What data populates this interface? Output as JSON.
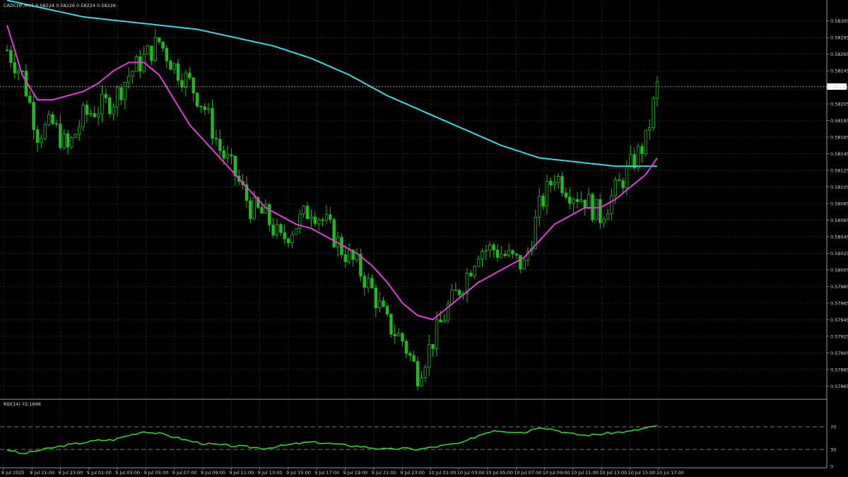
{
  "symbol_header": "CADCHF,M15  0.58224 0.58226 0.58224 0.58226",
  "rsi_header": "RSI(14) 72.1696",
  "colors": {
    "background": "#000000",
    "grid": "#3a3a3a",
    "candle": "#22b922",
    "ma_fast": "#e040d8",
    "ma_slow": "#40d8e0",
    "rsi": "#33dd33",
    "price_tag_bg": "#ffffff",
    "price_tag_text": "#000000",
    "hline": "#bfbfbf"
  },
  "chart_data": [
    {
      "type": "candlestick",
      "symbol": "CADCHF",
      "timeframe": "M15",
      "ylim": [
        0.57855,
        0.58315
      ],
      "price_ticks": [
        "0.58305",
        "0.58285",
        "0.58265",
        "0.58245",
        "0.58225",
        "0.58205",
        "0.58185",
        "0.58165",
        "0.58145",
        "0.58125",
        "0.58105",
        "0.58085",
        "0.58065",
        "0.58045",
        "0.58025",
        "0.58005",
        "0.57985",
        "0.57965",
        "0.57945",
        "0.57925",
        "0.57905",
        "0.57885",
        "0.57865"
      ],
      "current_price": "0.58226",
      "time_labels": [
        "8 Jul 2025",
        "8 Jul 21:00",
        "8 Jul 23:00",
        "9 Jul 01:00",
        "9 Jul 03:00",
        "9 Jul 05:00",
        "9 Jul 07:00",
        "9 Jul 09:00",
        "9 Jul 11:00",
        "9 Jul 13:00",
        "9 Jul 15:00",
        "9 Jul 17:00",
        "9 Jul 19:00",
        "9 Jul 21:00",
        "9 Jul 23:00",
        "10 Jul 01:00",
        "10 Jul 03:00",
        "10 Jul 05:00",
        "10 Jul 07:00",
        "10 Jul 09:00",
        "10 Jul 11:00",
        "10 Jul 13:00",
        "10 Jul 15:00",
        "10 Jul 17:00"
      ],
      "close_path": [
        [
          0,
          0.5827
        ],
        [
          4,
          0.5824
        ],
        [
          8,
          0.5817
        ],
        [
          12,
          0.5818
        ],
        [
          16,
          0.5815
        ],
        [
          20,
          0.5819
        ],
        [
          24,
          0.582
        ],
        [
          28,
          0.5821
        ],
        [
          32,
          0.5824
        ],
        [
          36,
          0.5826
        ],
        [
          40,
          0.5828
        ],
        [
          44,
          0.5825
        ],
        [
          48,
          0.5823
        ],
        [
          52,
          0.582
        ],
        [
          56,
          0.5815
        ],
        [
          60,
          0.5812
        ],
        [
          64,
          0.5808
        ],
        [
          68,
          0.5807
        ],
        [
          72,
          0.5804
        ],
        [
          76,
          0.5806
        ],
        [
          80,
          0.5808
        ],
        [
          84,
          0.5806
        ],
        [
          88,
          0.5803
        ],
        [
          92,
          0.5801
        ],
        [
          96,
          0.5798
        ],
        [
          100,
          0.5794
        ],
        [
          104,
          0.5792
        ],
        [
          108,
          0.5788
        ],
        [
          112,
          0.5792
        ],
        [
          116,
          0.5796
        ],
        [
          120,
          0.5799
        ],
        [
          124,
          0.5803
        ],
        [
          128,
          0.5803
        ],
        [
          132,
          0.5802
        ],
        [
          136,
          0.5801
        ],
        [
          140,
          0.5808
        ],
        [
          144,
          0.5812
        ],
        [
          148,
          0.581
        ],
        [
          152,
          0.5809
        ],
        [
          156,
          0.5807
        ],
        [
          160,
          0.581
        ],
        [
          164,
          0.5813
        ],
        [
          168,
          0.5816
        ],
        [
          171,
          0.58226
        ]
      ],
      "ma_fast": [
        [
          0,
          0.583
        ],
        [
          4,
          0.5824
        ],
        [
          8,
          0.5821
        ],
        [
          12,
          0.5821
        ],
        [
          16,
          0.58215
        ],
        [
          20,
          0.5822
        ],
        [
          24,
          0.5823
        ],
        [
          28,
          0.58245
        ],
        [
          32,
          0.58255
        ],
        [
          36,
          0.58255
        ],
        [
          40,
          0.5824
        ],
        [
          44,
          0.5821
        ],
        [
          48,
          0.5818
        ],
        [
          52,
          0.5816
        ],
        [
          56,
          0.5814
        ],
        [
          60,
          0.5812
        ],
        [
          64,
          0.581
        ],
        [
          68,
          0.5808
        ],
        [
          72,
          0.5807
        ],
        [
          76,
          0.5806
        ],
        [
          80,
          0.58055
        ],
        [
          84,
          0.58045
        ],
        [
          88,
          0.58035
        ],
        [
          92,
          0.58025
        ],
        [
          96,
          0.5801
        ],
        [
          100,
          0.5799
        ],
        [
          104,
          0.57965
        ],
        [
          108,
          0.5795
        ],
        [
          112,
          0.57945
        ],
        [
          116,
          0.5796
        ],
        [
          120,
          0.57975
        ],
        [
          124,
          0.5799
        ],
        [
          128,
          0.58
        ],
        [
          132,
          0.5801
        ],
        [
          136,
          0.5802
        ],
        [
          140,
          0.5804
        ],
        [
          144,
          0.5806
        ],
        [
          148,
          0.5807
        ],
        [
          152,
          0.5808
        ],
        [
          156,
          0.5808
        ],
        [
          160,
          0.5809
        ],
        [
          164,
          0.58105
        ],
        [
          168,
          0.5812
        ],
        [
          171,
          0.5814
        ]
      ],
      "ma_slow": [
        [
          0,
          0.5833
        ],
        [
          10,
          0.5832
        ],
        [
          20,
          0.5831
        ],
        [
          30,
          0.58305
        ],
        [
          40,
          0.583
        ],
        [
          50,
          0.58295
        ],
        [
          60,
          0.58285
        ],
        [
          70,
          0.58275
        ],
        [
          80,
          0.5826
        ],
        [
          90,
          0.5824
        ],
        [
          100,
          0.58215
        ],
        [
          110,
          0.58195
        ],
        [
          120,
          0.58175
        ],
        [
          130,
          0.58155
        ],
        [
          140,
          0.5814
        ],
        [
          150,
          0.58135
        ],
        [
          160,
          0.5813
        ],
        [
          171,
          0.5813
        ]
      ]
    },
    {
      "type": "line",
      "name": "RSI(14)",
      "ylim": [
        0,
        100
      ],
      "levels": [
        70,
        30
      ],
      "y_ticks": [
        "70",
        "30",
        "0"
      ],
      "values": [
        [
          0,
          30
        ],
        [
          4,
          22
        ],
        [
          8,
          28
        ],
        [
          12,
          33
        ],
        [
          16,
          38
        ],
        [
          20,
          42
        ],
        [
          24,
          46
        ],
        [
          28,
          47
        ],
        [
          32,
          55
        ],
        [
          36,
          62
        ],
        [
          40,
          58
        ],
        [
          44,
          52
        ],
        [
          48,
          45
        ],
        [
          52,
          40
        ],
        [
          56,
          38
        ],
        [
          60,
          36
        ],
        [
          64,
          34
        ],
        [
          68,
          32
        ],
        [
          72,
          36
        ],
        [
          76,
          40
        ],
        [
          80,
          43
        ],
        [
          84,
          41
        ],
        [
          88,
          38
        ],
        [
          92,
          36
        ],
        [
          96,
          33
        ],
        [
          100,
          30
        ],
        [
          104,
          32
        ],
        [
          108,
          30
        ],
        [
          112,
          34
        ],
        [
          116,
          38
        ],
        [
          120,
          42
        ],
        [
          124,
          55
        ],
        [
          128,
          64
        ],
        [
          132,
          62
        ],
        [
          136,
          60
        ],
        [
          140,
          70
        ],
        [
          144,
          65
        ],
        [
          148,
          58
        ],
        [
          152,
          55
        ],
        [
          156,
          57
        ],
        [
          160,
          60
        ],
        [
          164,
          62
        ],
        [
          168,
          68
        ],
        [
          171,
          72.17
        ]
      ]
    }
  ]
}
